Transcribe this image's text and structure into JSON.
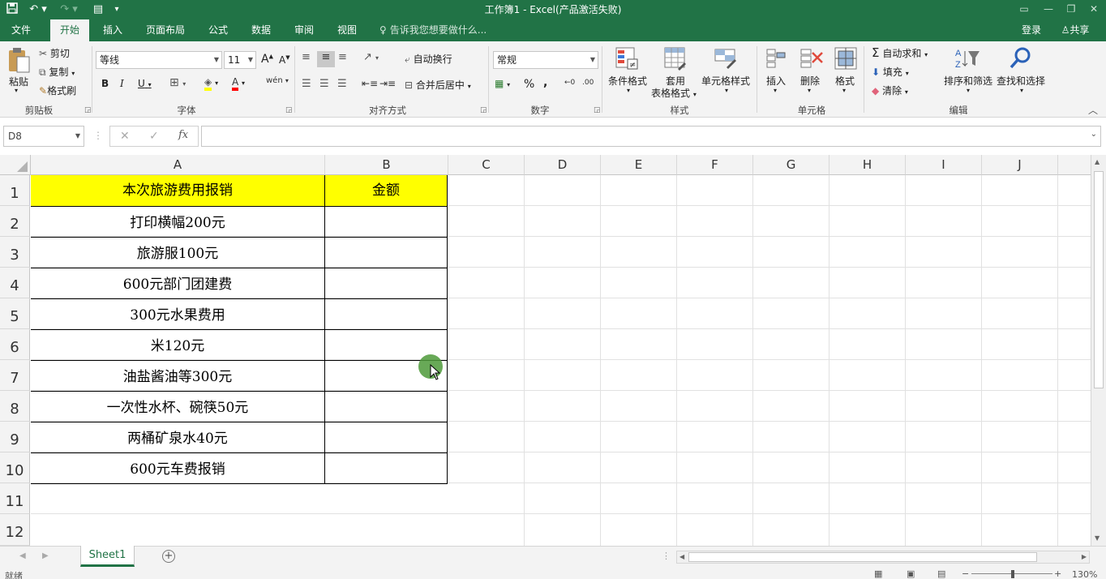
{
  "window": {
    "title": "工作簿1 - Excel(产品激活失败)"
  },
  "tabs": [
    {
      "label": "文件"
    },
    {
      "label": "开始"
    },
    {
      "label": "插入"
    },
    {
      "label": "页面布局"
    },
    {
      "label": "公式"
    },
    {
      "label": "数据"
    },
    {
      "label": "审阅"
    },
    {
      "label": "视图"
    }
  ],
  "tell_me": "告诉我您想要做什么...",
  "account": {
    "login": "登录",
    "share": "共享"
  },
  "ribbon": {
    "clipboard": {
      "paste": "粘贴",
      "cut": "剪切",
      "copy": "复制",
      "format_painter": "格式刷",
      "label": "剪贴板"
    },
    "font": {
      "name": "等线",
      "size": "11",
      "label": "字体",
      "wen": "wén",
      "bold": "B",
      "italic": "I",
      "underline": "U",
      "grow": "A",
      "shrink": "A"
    },
    "alignment": {
      "wrap": "自动换行",
      "merge": "合并后居中",
      "label": "对齐方式"
    },
    "number": {
      "format": "常规",
      "percent": "%",
      "comma": ",",
      "label": "数字"
    },
    "styles": {
      "conditional": "条件格式",
      "table_line1": "套用",
      "table_line2": "表格格式",
      "cell_styles": "单元格样式",
      "label": "样式"
    },
    "cells": {
      "insert": "插入",
      "delete": "删除",
      "format": "格式",
      "label": "单元格"
    },
    "editing": {
      "autosum": "自动求和",
      "fill": "填充",
      "clear": "清除",
      "sort": "排序和筛选",
      "find": "查找和选择",
      "label": "编辑"
    }
  },
  "formula_bar": {
    "name_box": "D8",
    "fx": "fx",
    "content": ""
  },
  "columns": [
    "A",
    "B",
    "C",
    "D",
    "E",
    "F",
    "G",
    "H",
    "I",
    "J"
  ],
  "rows": [
    "1",
    "2",
    "3",
    "4",
    "5",
    "6",
    "7",
    "8",
    "9",
    "10",
    "11",
    "12"
  ],
  "table": {
    "header": [
      "本次旅游费用报销",
      "金额"
    ],
    "rows": [
      [
        "打印横幅200元",
        ""
      ],
      [
        "旅游服100元",
        ""
      ],
      [
        "600元部门团建费",
        ""
      ],
      [
        "300元水果费用",
        ""
      ],
      [
        "米120元",
        ""
      ],
      [
        "油盐酱油等300元",
        ""
      ],
      [
        "一次性水杯、碗筷50元",
        ""
      ],
      [
        "两桶矿泉水40元",
        ""
      ],
      [
        "600元车费报销",
        ""
      ]
    ]
  },
  "sheet_tabs": [
    {
      "label": "Sheet1"
    }
  ],
  "status": {
    "ready": "就绪",
    "zoom": "130%"
  },
  "colors": {
    "excel_green": "#217346",
    "header_fill": "#ffff00",
    "cursor_marker": "#4e9a3a"
  }
}
